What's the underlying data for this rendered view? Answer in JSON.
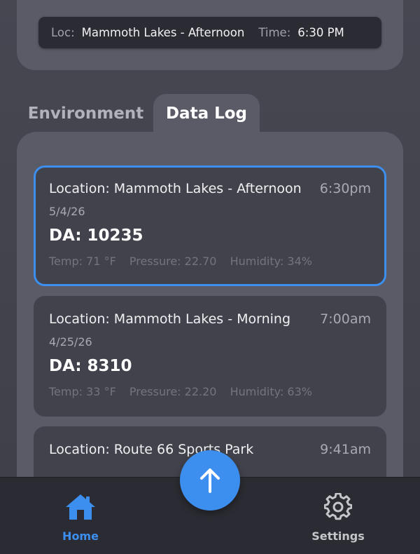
{
  "location_bar": {
    "loc_label": "Loc:",
    "loc_value": "Mammoth Lakes - Afternoon",
    "time_label": "Time:",
    "time_value": "6:30 PM"
  },
  "tabs": [
    {
      "label": "Environment",
      "active": false
    },
    {
      "label": "Data Log",
      "active": true
    }
  ],
  "log_entries": [
    {
      "title": "Location: Mammoth Lakes - Afternoon",
      "time": "6:30pm",
      "date": "5/4/26",
      "da": "DA: 10235",
      "temp": "Temp: 71 °F",
      "pressure": "Pressure: 22.70",
      "humidity": "Humidity: 34%",
      "selected": true
    },
    {
      "title": "Location: Mammoth Lakes - Morning",
      "time": "7:00am",
      "date": "4/25/26",
      "da": "DA: 8310",
      "temp": "Temp: 33 °F",
      "pressure": "Pressure: 22.20",
      "humidity": "Humidity: 63%",
      "selected": false
    },
    {
      "title": "Location: Route 66 Sports Park",
      "time": "9:41am",
      "selected": false
    }
  ],
  "bottom_nav": {
    "home_label": "Home",
    "home_icon": "house-icon",
    "settings_label": "Settings",
    "settings_icon": "gear-icon",
    "fab_icon": "arrow-up-icon"
  },
  "colors": {
    "accent": "#3d8fef",
    "background": "#3f3f49",
    "panel": "#5b5b67",
    "card": "#42424c",
    "bar": "#2b2b33"
  }
}
